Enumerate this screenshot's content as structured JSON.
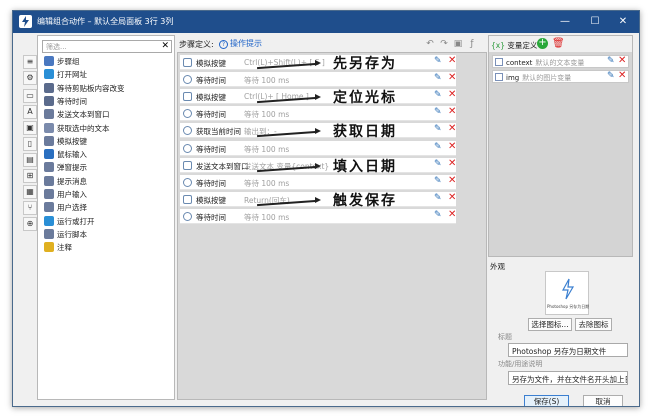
{
  "window": {
    "title": "编辑组合动作 – 默认全局面板 3行 3列",
    "minimize": "—",
    "maximize": "☐",
    "close": "✕"
  },
  "left_toolbar": [
    "≡",
    "⚙",
    "▭",
    "A",
    "▣",
    "▯",
    "▤",
    "⊞",
    "▦",
    "⑂",
    "⊕"
  ],
  "action_panel": {
    "filter_placeholder": "筛选...",
    "clear": "✕",
    "items": [
      {
        "label": "步骤组",
        "color": "#4a78c0"
      },
      {
        "label": "打开网址",
        "color": "#2a8fd6"
      },
      {
        "label": "等待剪贴板内容改变",
        "color": "#5b6b8c"
      },
      {
        "label": "等待时间",
        "color": "#5b6b8c"
      },
      {
        "label": "发送文本到窗口",
        "color": "#6b7b9c"
      },
      {
        "label": "获取选中的文本",
        "color": "#7b8bac"
      },
      {
        "label": "模拟按键",
        "color": "#6b7b9c"
      },
      {
        "label": "鼠标输入",
        "color": "#2a6fc0"
      },
      {
        "label": "弹窗提示",
        "color": "#6b7b9c"
      },
      {
        "label": "提示消息",
        "color": "#6b7b9c"
      },
      {
        "label": "用户输入",
        "color": "#6b7b9c"
      },
      {
        "label": "用户选择",
        "color": "#6b7b9c"
      },
      {
        "label": "运行或打开",
        "color": "#2a8fd6"
      },
      {
        "label": "运行脚本",
        "color": "#6b7b9c"
      },
      {
        "label": "注释",
        "color": "#e0b020"
      }
    ]
  },
  "steps_header": {
    "label": "步骤定义:",
    "hint": "操作提示",
    "hint_icon": "?"
  },
  "steps": [
    {
      "name": "模拟按键",
      "param": "Ctrl(L)+Shift(L)+ [ S ]",
      "icon": "keyboard"
    },
    {
      "name": "等待时间",
      "param": "等待 100 ms",
      "icon": "clock"
    },
    {
      "name": "模拟按键",
      "param": "Ctrl(L)+ [ Home ]",
      "icon": "keyboard"
    },
    {
      "name": "等待时间",
      "param": "等待 100 ms",
      "icon": "clock"
    },
    {
      "name": "获取当前时间",
      "param": "输出到：-",
      "icon": "clock"
    },
    {
      "name": "等待时间",
      "param": "等待 100 ms",
      "icon": "clock"
    },
    {
      "name": "发送文本到窗口",
      "param": "发送文本 变量{context}",
      "icon": "window"
    },
    {
      "name": "等待时间",
      "param": "等待 100 ms",
      "icon": "clock"
    },
    {
      "name": "模拟按键",
      "param": "Return(回车)",
      "icon": "keyboard"
    },
    {
      "name": "等待时间",
      "param": "等待 100 ms",
      "icon": "clock"
    }
  ],
  "annotations": [
    "先另存为",
    "定位光标",
    "获取日期",
    "填入日期",
    "触发保存"
  ],
  "variables": {
    "header": "变量定义",
    "items": [
      {
        "name": "context",
        "desc": "默认的文本变量"
      },
      {
        "name": "img",
        "desc": "默认的图片变量"
      }
    ]
  },
  "appearance": {
    "section": "外观",
    "icon_caption": "Photoshop 另存为日期文件",
    "select_icon": "选择图标...",
    "remove_icon": "去除图标",
    "title_label": "标题",
    "title_value": "Photoshop 另存为日期文件",
    "desc_label": "功能/用途说明",
    "desc_value": "另存为文件，并在文件名开头加上日期"
  },
  "footer": {
    "save": "保存(S)",
    "cancel": "取消"
  },
  "colors": {
    "titlebar": "#1f4e8c",
    "accent": "#2064c8",
    "delete": "#dd2222"
  }
}
